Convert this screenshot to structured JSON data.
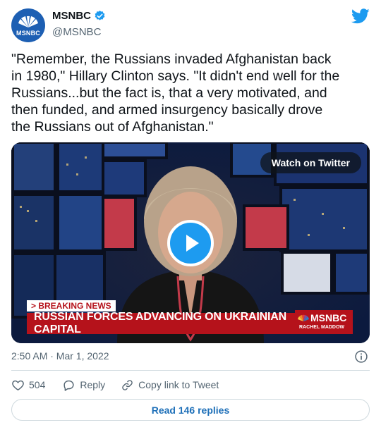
{
  "account": {
    "display_name": "MSNBC",
    "handle": "@MSNBC",
    "avatar_text": "MSNBC",
    "verified": true
  },
  "tweet": {
    "text": "\"Remember, the Russians invaded Afghanistan back in 1980,\" Hillary Clinton says. \"It didn't end well for the Russians...but the fact is, that a very motivated, and then funded, and armed insurgency basically drove the Russians out of Afghanistan.\""
  },
  "media": {
    "watch_label": "Watch on Twitter",
    "breaking_label": "> BREAKING NEWS",
    "headline": "RUSSIAN FORCES ADVANCING ON UKRAINIAN CAPITAL",
    "logo_name": "MSNBC",
    "logo_sub": "RACHEL MADDOW"
  },
  "meta": {
    "timestamp": "2:50 AM · Mar 1, 2022"
  },
  "actions": {
    "like_count": "504",
    "reply_label": "Reply",
    "copy_label": "Copy link to Tweet"
  },
  "footer": {
    "replies_label": "Read 146 replies"
  },
  "colors": {
    "twitter_blue": "#1d9bf0",
    "link_blue": "#1d6fb8",
    "msnbc_red": "#b5121b",
    "text_secondary": "#536471"
  },
  "icons": [
    "verified-badge-icon",
    "twitter-bird-icon",
    "play-icon",
    "info-icon",
    "heart-icon",
    "reply-bubble-icon",
    "link-icon",
    "peacock-icon"
  ]
}
